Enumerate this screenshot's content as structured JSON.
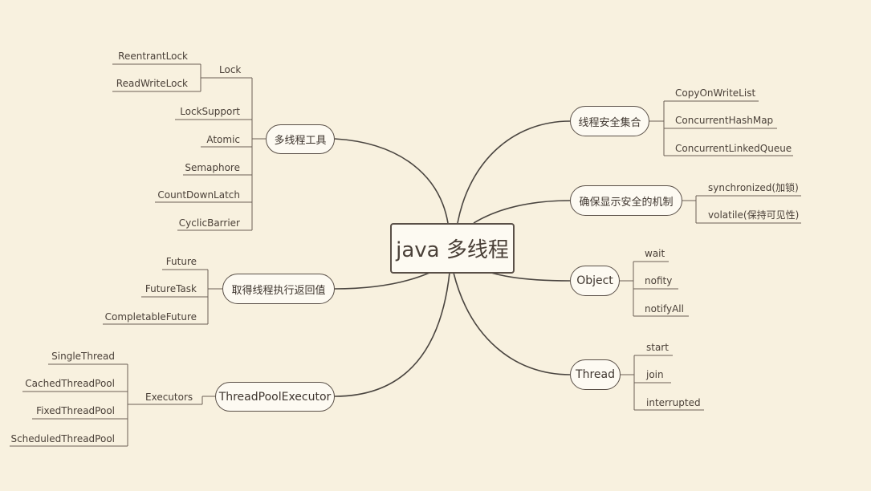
{
  "root": "java 多线程",
  "branches": {
    "tools": {
      "label": "多线程工具",
      "lock": {
        "label": "Lock",
        "children": [
          "ReentrantLock",
          "ReadWriteLock"
        ]
      },
      "items": [
        "LockSupport",
        "Atomic",
        "Semaphore",
        "CountDownLatch",
        "CyclicBarrier"
      ]
    },
    "future": {
      "label": "取得线程执行返回值",
      "children": [
        "Future",
        "FutureTask",
        "CompletableFuture"
      ]
    },
    "pool": {
      "label": "ThreadPoolExecutor",
      "executors": {
        "label": "Executors",
        "children": [
          "SingleThread",
          "CachedThreadPool",
          "FixedThreadPool",
          "ScheduledThreadPool"
        ]
      }
    },
    "collections": {
      "label": "线程安全集合",
      "children": [
        "CopyOnWriteList",
        "ConcurrentHashMap",
        "ConcurrentLinkedQueue"
      ]
    },
    "visibility": {
      "label": "确保显示安全的机制",
      "children": [
        "synchronized(加锁)",
        "volatile(保持可见性)"
      ]
    },
    "object": {
      "label": "Object",
      "children": [
        "wait",
        "nofity",
        "notifyAll"
      ]
    },
    "thread": {
      "label": "Thread",
      "children": [
        "start",
        "join",
        "interrupted"
      ]
    }
  }
}
